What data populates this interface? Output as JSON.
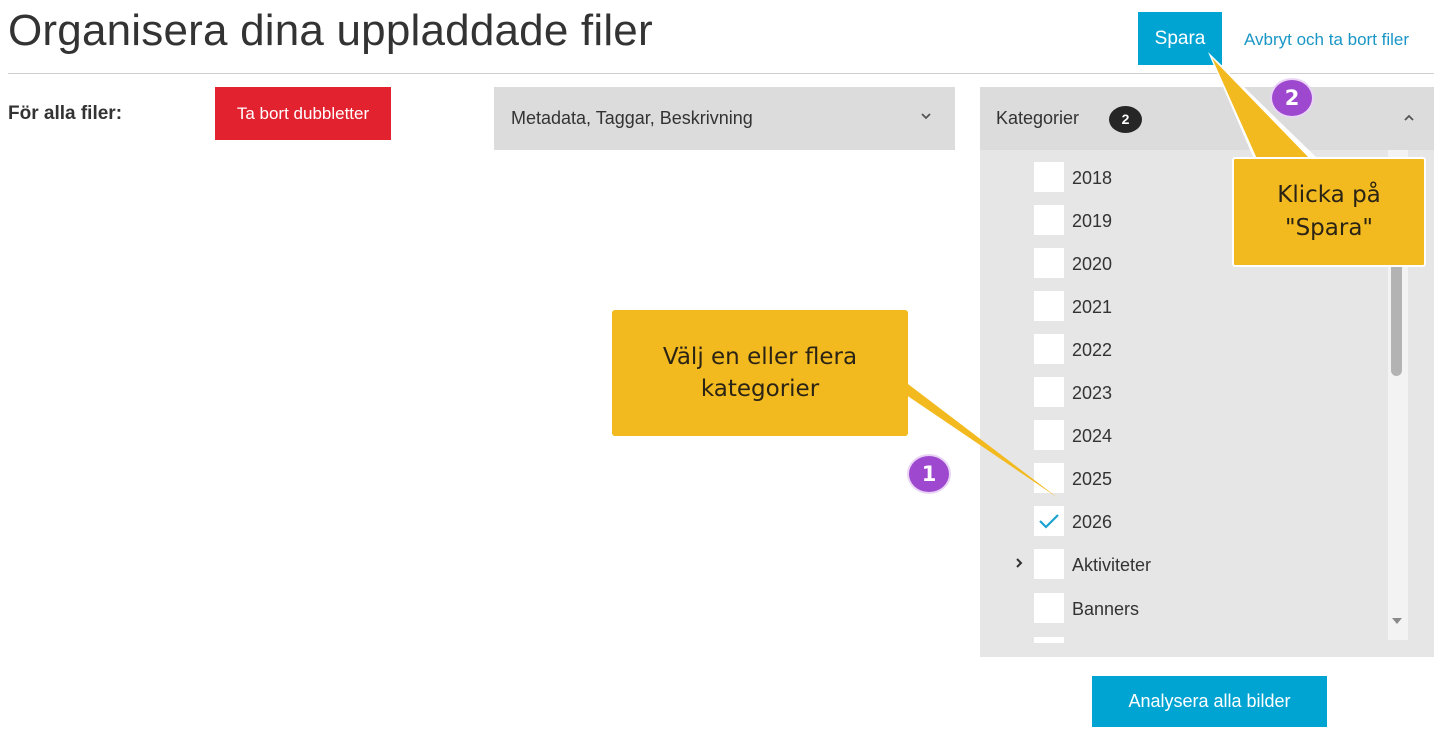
{
  "header": {
    "title": "Organisera dina uppladdade filer",
    "save_label": "Spara",
    "cancel_label": "Avbryt och ta bort filer"
  },
  "toolbar": {
    "all_files_label": "För alla filer:",
    "remove_duplicates_label": "Ta bort dubbletter"
  },
  "metadata_panel": {
    "label": "Metadata, Taggar, Beskrivning",
    "expanded": false
  },
  "categories_panel": {
    "label": "Kategorier",
    "selected_count": "2",
    "expanded": true,
    "items": [
      {
        "label": "2018",
        "checked": false,
        "has_children": false
      },
      {
        "label": "2019",
        "checked": false,
        "has_children": false
      },
      {
        "label": "2020",
        "checked": false,
        "has_children": false
      },
      {
        "label": "2021",
        "checked": false,
        "has_children": false
      },
      {
        "label": "2022",
        "checked": false,
        "has_children": false
      },
      {
        "label": "2023",
        "checked": false,
        "has_children": false
      },
      {
        "label": "2024",
        "checked": false,
        "has_children": false
      },
      {
        "label": "2025",
        "checked": false,
        "has_children": false
      },
      {
        "label": "2026",
        "checked": true,
        "has_children": false
      },
      {
        "label": "Aktiviteter",
        "checked": false,
        "has_children": true
      },
      {
        "label": "Banners",
        "checked": false,
        "has_children": false
      }
    ]
  },
  "actions": {
    "analyze_label": "Analysera alla bilder"
  },
  "callouts": {
    "step1_number": "1",
    "step1_text_line1": "Välj en eller flera",
    "step1_text_line2": "kategorier",
    "step2_number": "2",
    "step2_text_line1": "Klicka på",
    "step2_text_line2": "\"Spara\""
  },
  "colors": {
    "accent": "#00a4d3",
    "danger": "#e2222f",
    "callout": "#f3ba20",
    "step_badge": "#9e48cf",
    "link": "#1a96c6"
  }
}
